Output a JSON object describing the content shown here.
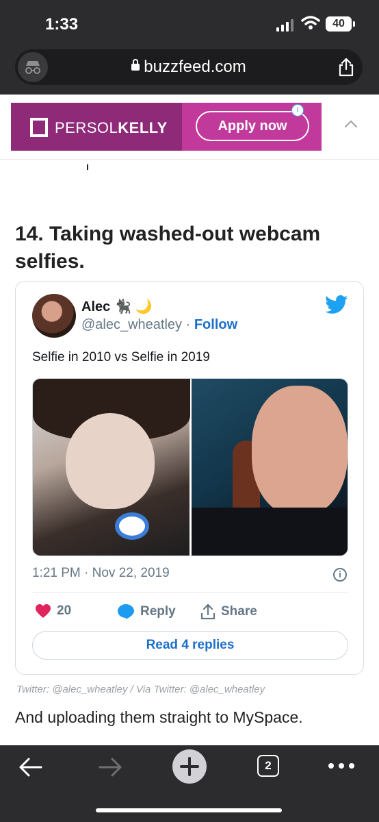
{
  "status_bar": {
    "time": "1:33",
    "battery": "40"
  },
  "browser": {
    "url": "buzzfeed.com",
    "tab_count": "2"
  },
  "ad": {
    "brand_light": "PERSOL",
    "brand_bold": "KELLY",
    "cta": "Apply now",
    "info": "i"
  },
  "article": {
    "heading": "14. Taking washed-out webcam selfies.",
    "credit": "Twitter: @alec_wheatley / Via Twitter: @alec_wheatley",
    "body": "And uploading them straight to MySpace."
  },
  "tweet": {
    "author": "Alec",
    "author_emoji": "🐈‍⬛ 🌙",
    "handle": "@alec_wheatley",
    "separator": " · ",
    "follow": "Follow",
    "text": "Selfie in 2010 vs Selfie in 2019",
    "timestamp": "1:21 PM · Nov 22, 2019",
    "like_count": "20",
    "reply_label": "Reply",
    "share_label": "Share",
    "read_replies": "Read 4 replies"
  },
  "colors": {
    "accent": "#1b6fc9",
    "like": "#e0245e",
    "ad_bg": "#c13a9b"
  }
}
